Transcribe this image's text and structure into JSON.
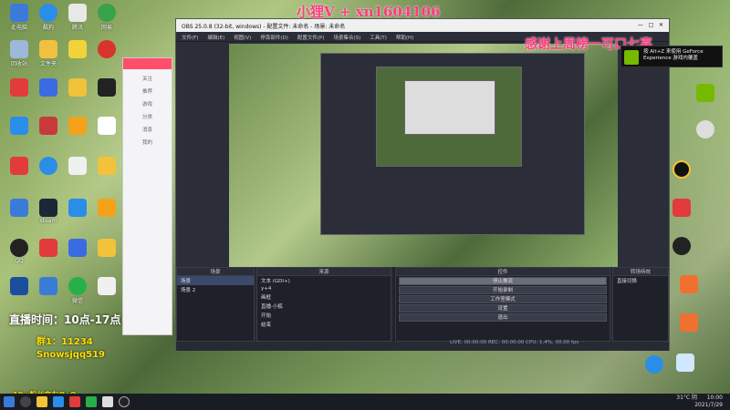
{
  "watermark": "小狸V + xn1604106",
  "thanks_banner": "感谢上周榜一可口七喜",
  "nvidia_toast": {
    "line1": "按 Alt+Z 来使用 GeForce",
    "line2": "Experience 游戏内覆盖"
  },
  "obs": {
    "title": "OBS 25.0.8 (32-bit, windows) - 配置文件: 未命名 - 场景: 未命名",
    "menu": [
      "文件(F)",
      "编辑(E)",
      "视图(V)",
      "停靠部件(D)",
      "配置文件(P)",
      "场景集合(S)",
      "工具(T)",
      "帮助(H)"
    ],
    "docks": {
      "scenes_title": "场景",
      "scenes": [
        "场景",
        "场景 2"
      ],
      "sources_title": "来源",
      "sources": [
        "文本 (GDI+)",
        "y+4",
        "画框",
        "直播·小狐",
        "开始",
        "结束"
      ],
      "mixer_title": "混音器",
      "mixer_label": "音频",
      "controls_title": "控件",
      "controls": [
        "停止推流",
        "开始录制",
        "工作室模式",
        "设置",
        "退出"
      ],
      "transitions_title": "转场特效",
      "transition_value": "直接切换"
    },
    "status": "LIVE: 00:00:00   REC: 00:00:00   CPU: 1.4%, 30.00 fps"
  },
  "overlays": {
    "live_time": "直播时间：10点-17点",
    "line2": "群1：11234",
    "line3": "Snowsjqq519",
    "fans_group": "10w粉丝交友QoQ"
  },
  "chat_app": {
    "items": [
      "关注",
      "推荐",
      "游戏",
      "分类",
      "消息",
      "我的"
    ]
  },
  "tray": {
    "weather": "31°C 阴",
    "time": "10:00",
    "date": "2021/7/29"
  },
  "desktop_icon_labels": [
    "此电脑",
    "酷狗",
    "腾讯",
    "网易",
    "回收站",
    "文件夹",
    "QQ",
    "微信",
    "steam",
    "浏览器"
  ]
}
